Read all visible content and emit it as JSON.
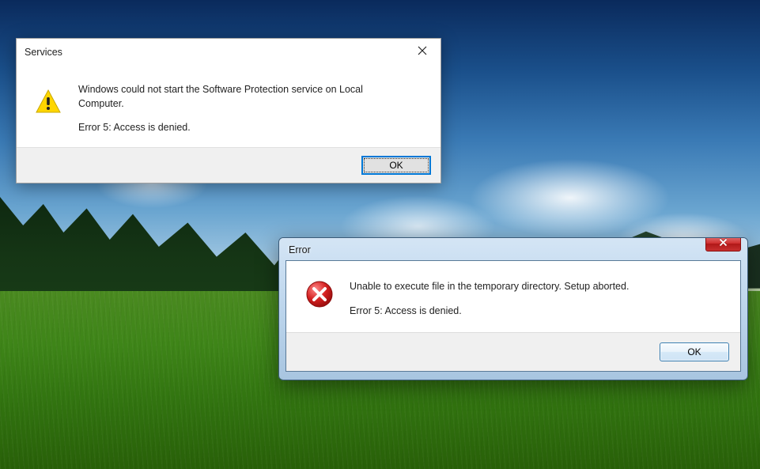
{
  "services_dialog": {
    "title": "Services",
    "message_line1": "Windows could not start the Software Protection service on Local Computer.",
    "message_line2": "Error 5: Access is denied.",
    "ok_label": "OK"
  },
  "error_dialog": {
    "title": "Error",
    "message_line1": "Unable to execute file in the temporary directory. Setup aborted.",
    "message_line2": "Error 5: Access is denied.",
    "ok_label": "OK"
  }
}
